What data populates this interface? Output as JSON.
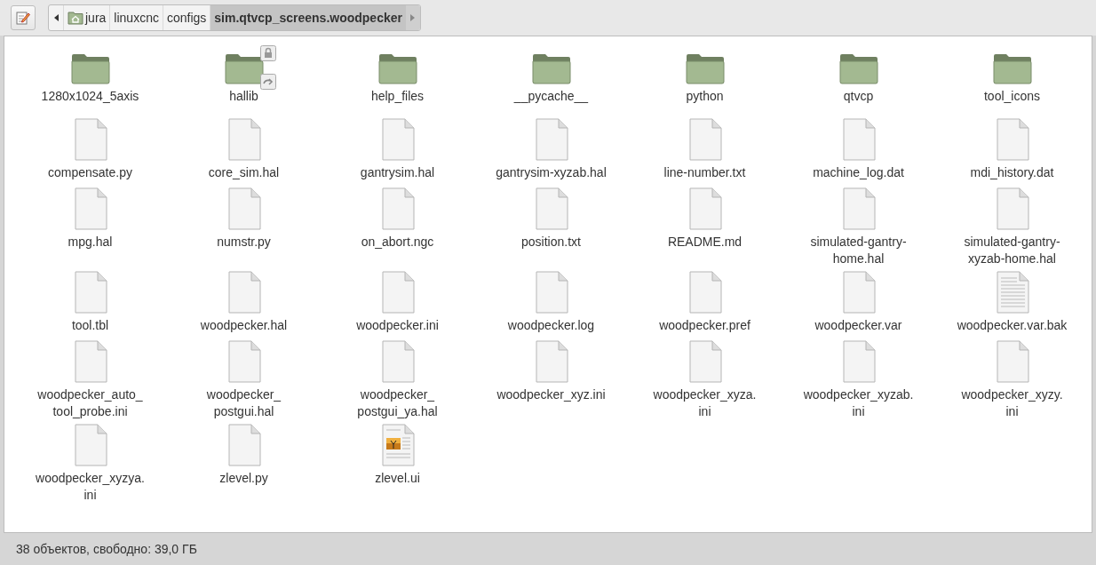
{
  "path_bar": {
    "segments": [
      {
        "label": "jura",
        "kind": "home",
        "selected": false
      },
      {
        "label": "linuxcnc",
        "kind": "folder",
        "selected": false
      },
      {
        "label": "configs",
        "kind": "folder",
        "selected": false
      },
      {
        "label": "sim.qtvcp_screens.woodpecker",
        "kind": "folder",
        "selected": true
      }
    ]
  },
  "files": [
    {
      "name": "1280x1024_5axis",
      "kind": "folder"
    },
    {
      "name": "hallib",
      "kind": "folder",
      "locked": true,
      "link": true
    },
    {
      "name": "help_files",
      "kind": "folder"
    },
    {
      "name": "__pycache__",
      "kind": "folder"
    },
    {
      "name": "python",
      "kind": "folder"
    },
    {
      "name": "qtvcp",
      "kind": "folder"
    },
    {
      "name": "tool_icons",
      "kind": "folder"
    },
    {
      "name": "compensate.py",
      "kind": "file"
    },
    {
      "name": "core_sim.hal",
      "kind": "file"
    },
    {
      "name": "gantrysim.hal",
      "kind": "file"
    },
    {
      "name": "gantrysim-xyzab.hal",
      "kind": "file"
    },
    {
      "name": "line-number.txt",
      "kind": "file"
    },
    {
      "name": "machine_log.dat",
      "kind": "file"
    },
    {
      "name": "mdi_history.dat",
      "kind": "file"
    },
    {
      "name": "mpg.hal",
      "kind": "file"
    },
    {
      "name": "numstr.py",
      "kind": "file"
    },
    {
      "name": "on_abort.ngc",
      "kind": "file"
    },
    {
      "name": "position.txt",
      "kind": "file"
    },
    {
      "name": "README.md",
      "kind": "file"
    },
    {
      "name": "simulated-gantry-\nhome.hal",
      "kind": "file"
    },
    {
      "name": "simulated-gantry-\nxyzab-home.hal",
      "kind": "file"
    },
    {
      "name": "tool.tbl",
      "kind": "file"
    },
    {
      "name": "woodpecker.hal",
      "kind": "file"
    },
    {
      "name": "woodpecker.ini",
      "kind": "file"
    },
    {
      "name": "woodpecker.log",
      "kind": "file"
    },
    {
      "name": "woodpecker.pref",
      "kind": "file"
    },
    {
      "name": "woodpecker.var",
      "kind": "file"
    },
    {
      "name": "woodpecker.var.bak",
      "kind": "text"
    },
    {
      "name": "woodpecker_auto_\ntool_probe.ini",
      "kind": "file"
    },
    {
      "name": "woodpecker_\npostgui.hal",
      "kind": "file"
    },
    {
      "name": "woodpecker_\npostgui_ya.hal",
      "kind": "file"
    },
    {
      "name": "woodpecker_xyz.ini",
      "kind": "file"
    },
    {
      "name": "woodpecker_xyza.\nini",
      "kind": "file"
    },
    {
      "name": "woodpecker_xyzab.\nini",
      "kind": "file"
    },
    {
      "name": "woodpecker_xyzy.\nini",
      "kind": "file"
    },
    {
      "name": "woodpecker_xyzya.\nini",
      "kind": "file"
    },
    {
      "name": "zlevel.py",
      "kind": "file"
    },
    {
      "name": "zlevel.ui",
      "kind": "ui"
    }
  ],
  "status_bar": "38 объектов, свободно: 39,0 ГБ"
}
